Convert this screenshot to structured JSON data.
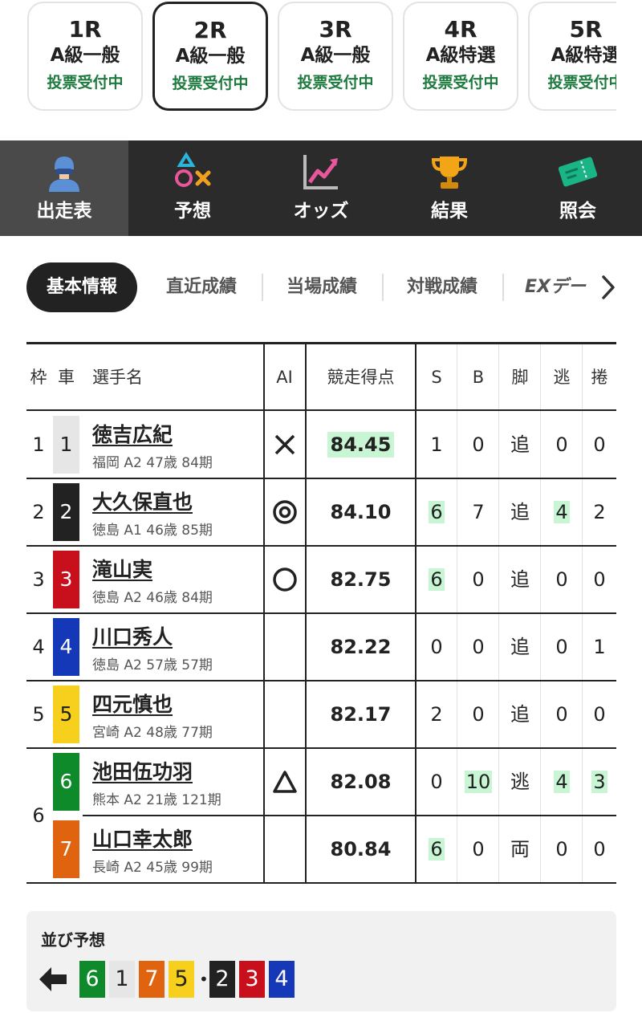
{
  "races": [
    {
      "num": "1R",
      "grade": "A級一般",
      "status": "投票受付中",
      "active": false
    },
    {
      "num": "2R",
      "grade": "A級一般",
      "status": "投票受付中",
      "active": true
    },
    {
      "num": "3R",
      "grade": "A級一般",
      "status": "投票受付中",
      "active": false
    },
    {
      "num": "4R",
      "grade": "A級特選",
      "status": "投票受付中",
      "active": false
    },
    {
      "num": "5R",
      "grade": "A級特選",
      "status": "投票受付中",
      "active": false
    }
  ],
  "nav": [
    {
      "label": "出走表",
      "icon": "racer-icon",
      "active": true
    },
    {
      "label": "予想",
      "icon": "prediction-icon",
      "active": false
    },
    {
      "label": "オッズ",
      "icon": "odds-chart-icon",
      "active": false
    },
    {
      "label": "結果",
      "icon": "trophy-icon",
      "active": false
    },
    {
      "label": "照会",
      "icon": "ticket-icon",
      "active": false
    }
  ],
  "subtabs": [
    "基本情報",
    "直近成績",
    "当場成績",
    "対戦成績",
    "EXデー"
  ],
  "table": {
    "headers": {
      "waku": "枠",
      "car": "車",
      "name": "選手名",
      "ai": "AI",
      "score": "競走得点",
      "s": "S",
      "b": "B",
      "leg": "脚",
      "nige": "逃",
      "makuri": "捲"
    },
    "rows": [
      {
        "waku": "1",
        "car": "1",
        "name": "徳吉広紀",
        "info": "福岡 A2 47歳 84期",
        "ai": "cross",
        "score": "84.45",
        "score_hl": true,
        "s": "1",
        "s_hl": false,
        "b": "0",
        "b_hl": false,
        "leg": "追",
        "nige": "0",
        "nige_hl": false,
        "makuri": "0",
        "makuri_hl": false
      },
      {
        "waku": "2",
        "car": "2",
        "name": "大久保直也",
        "info": "徳島 A1 46歳 85期",
        "ai": "double-circle",
        "score": "84.10",
        "score_hl": false,
        "s": "6",
        "s_hl": true,
        "b": "7",
        "b_hl": false,
        "leg": "追",
        "nige": "4",
        "nige_hl": true,
        "makuri": "2",
        "makuri_hl": false
      },
      {
        "waku": "3",
        "car": "3",
        "name": "滝山実",
        "info": "徳島 A2 46歳 84期",
        "ai": "circle",
        "score": "82.75",
        "score_hl": false,
        "s": "6",
        "s_hl": true,
        "b": "0",
        "b_hl": false,
        "leg": "追",
        "nige": "0",
        "nige_hl": false,
        "makuri": "0",
        "makuri_hl": false
      },
      {
        "waku": "4",
        "car": "4",
        "name": "川口秀人",
        "info": "徳島 A2 57歳 57期",
        "ai": "",
        "score": "82.22",
        "score_hl": false,
        "s": "0",
        "s_hl": false,
        "b": "0",
        "b_hl": false,
        "leg": "追",
        "nige": "0",
        "nige_hl": false,
        "makuri": "1",
        "makuri_hl": false
      },
      {
        "waku": "5",
        "car": "5",
        "name": "四元慎也",
        "info": "宮崎 A2 48歳 77期",
        "ai": "",
        "score": "82.17",
        "score_hl": false,
        "s": "2",
        "s_hl": false,
        "b": "0",
        "b_hl": false,
        "leg": "追",
        "nige": "0",
        "nige_hl": false,
        "makuri": "0",
        "makuri_hl": false
      },
      {
        "waku": "6",
        "car": "6",
        "name": "池田伍功羽",
        "info": "熊本 A2 21歳 121期",
        "ai": "triangle",
        "score": "82.08",
        "score_hl": false,
        "s": "0",
        "s_hl": false,
        "b": "10",
        "b_hl": true,
        "leg": "逃",
        "nige": "4",
        "nige_hl": true,
        "makuri": "3",
        "makuri_hl": true
      },
      {
        "waku": "",
        "car": "7",
        "name": "山口幸太郎",
        "info": "長崎 A2 45歳 99期",
        "ai": "",
        "score": "80.84",
        "score_hl": false,
        "s": "6",
        "s_hl": true,
        "b": "0",
        "b_hl": false,
        "leg": "両",
        "nige": "0",
        "nige_hl": false,
        "makuri": "0",
        "makuri_hl": false
      }
    ]
  },
  "line_prediction": {
    "title": "並び予想",
    "groups": [
      [
        "6",
        "1",
        "7",
        "5"
      ],
      [
        "2",
        "3",
        "4"
      ]
    ]
  },
  "car_colors": {
    "1": {
      "bg": "#e6e6e6",
      "fg": "#222222"
    },
    "2": {
      "bg": "#222222",
      "fg": "#ffffff"
    },
    "3": {
      "bg": "#c8101c",
      "fg": "#ffffff"
    },
    "4": {
      "bg": "#1438b8",
      "fg": "#ffffff"
    },
    "5": {
      "bg": "#f7cf1d",
      "fg": "#222222"
    },
    "6": {
      "bg": "#0f8a2a",
      "fg": "#ffffff"
    },
    "7": {
      "bg": "#e0630f",
      "fg": "#ffffff"
    }
  },
  "accent": {
    "status_green": "#1e7a3e",
    "highlight": "#c8f5d3"
  }
}
